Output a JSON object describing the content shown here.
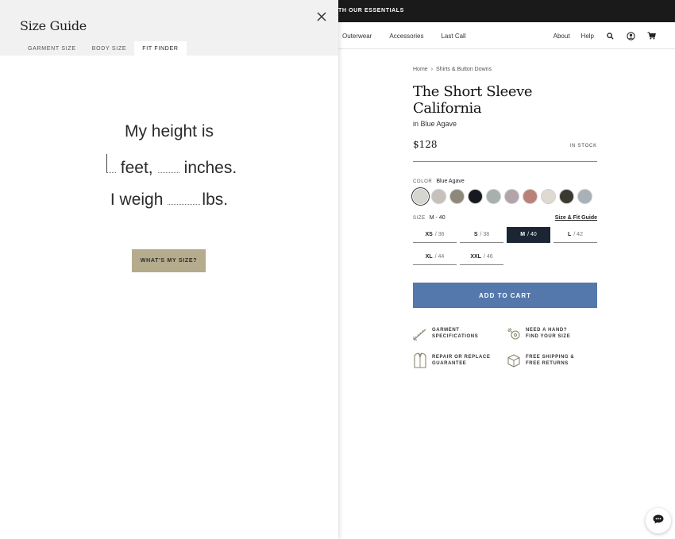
{
  "promo": {
    "text": "TH OUR ESSENTIALS"
  },
  "nav": {
    "left_items": [
      "Outerwear",
      "Accessories",
      "Last Call"
    ],
    "right_items": [
      "About",
      "Help"
    ],
    "icons": [
      "search-icon",
      "account-icon",
      "cart-icon"
    ]
  },
  "product": {
    "breadcrumb": [
      "Home",
      "Shirts & Button Downs"
    ],
    "breadcrumb_separator": "›",
    "title": "The Short Sleeve California",
    "variant": "in Blue Agave",
    "price": "$128",
    "stock": "IN STOCK",
    "color_label": "COLOR",
    "color_value": "Blue Agave",
    "swatches": [
      "#d6d6d1",
      "#c6c2bb",
      "#8e887b",
      "#161a20",
      "#a8b0ad",
      "#b3a4a9",
      "#b88278",
      "#e0d9d2",
      "#3a3a30",
      "#a8b1b8"
    ],
    "size_label": "SIZE",
    "size_value": "M - 40",
    "size_guide_link": "Size & Fit Guide",
    "sizes": [
      {
        "label": "XS",
        "num": "/ 36"
      },
      {
        "label": "S",
        "num": "/ 38"
      },
      {
        "label": "M",
        "num": "/ 40"
      },
      {
        "label": "L",
        "num": "/ 42"
      },
      {
        "label": "XL",
        "num": "/ 44"
      },
      {
        "label": "XXL",
        "num": "/ 46"
      }
    ],
    "selected_size": "M",
    "add_to_cart": "ADD TO CART",
    "features": [
      {
        "line1": "GARMENT",
        "line2": "SPECIFICATIONS",
        "icon": "ruler-icon"
      },
      {
        "line1": "NEED A HAND?",
        "line2": "FIND YOUR SIZE",
        "icon": "tape-measure-icon"
      },
      {
        "line1": "REPAIR OR REPLACE",
        "line2": "GUARANTEE",
        "icon": "shirt-icon"
      },
      {
        "line1": "FREE SHIPPING &",
        "line2": "FREE RETURNS",
        "icon": "box-icon"
      }
    ]
  },
  "size_guide": {
    "title": "Size Guide",
    "tabs": [
      "GARMENT SIZE",
      "BODY SIZE",
      "FIT FINDER"
    ],
    "active_tab": "FIT FINDER",
    "fit_finder": {
      "line1": "My height is",
      "feet_label": "feet,",
      "inches_label": "inches.",
      "weigh_label": "I weigh",
      "lbs_label": "lbs.",
      "feet_value": "",
      "inches_value": "",
      "weight_value": ""
    },
    "cta": "WHAT'S MY SIZE?"
  },
  "colors": {
    "accent_blue": "#5478ab",
    "selected_size_bg": "#1b2533",
    "cta_bg": "#b5ab8d",
    "drawer_header_bg": "#f1f1f1"
  }
}
